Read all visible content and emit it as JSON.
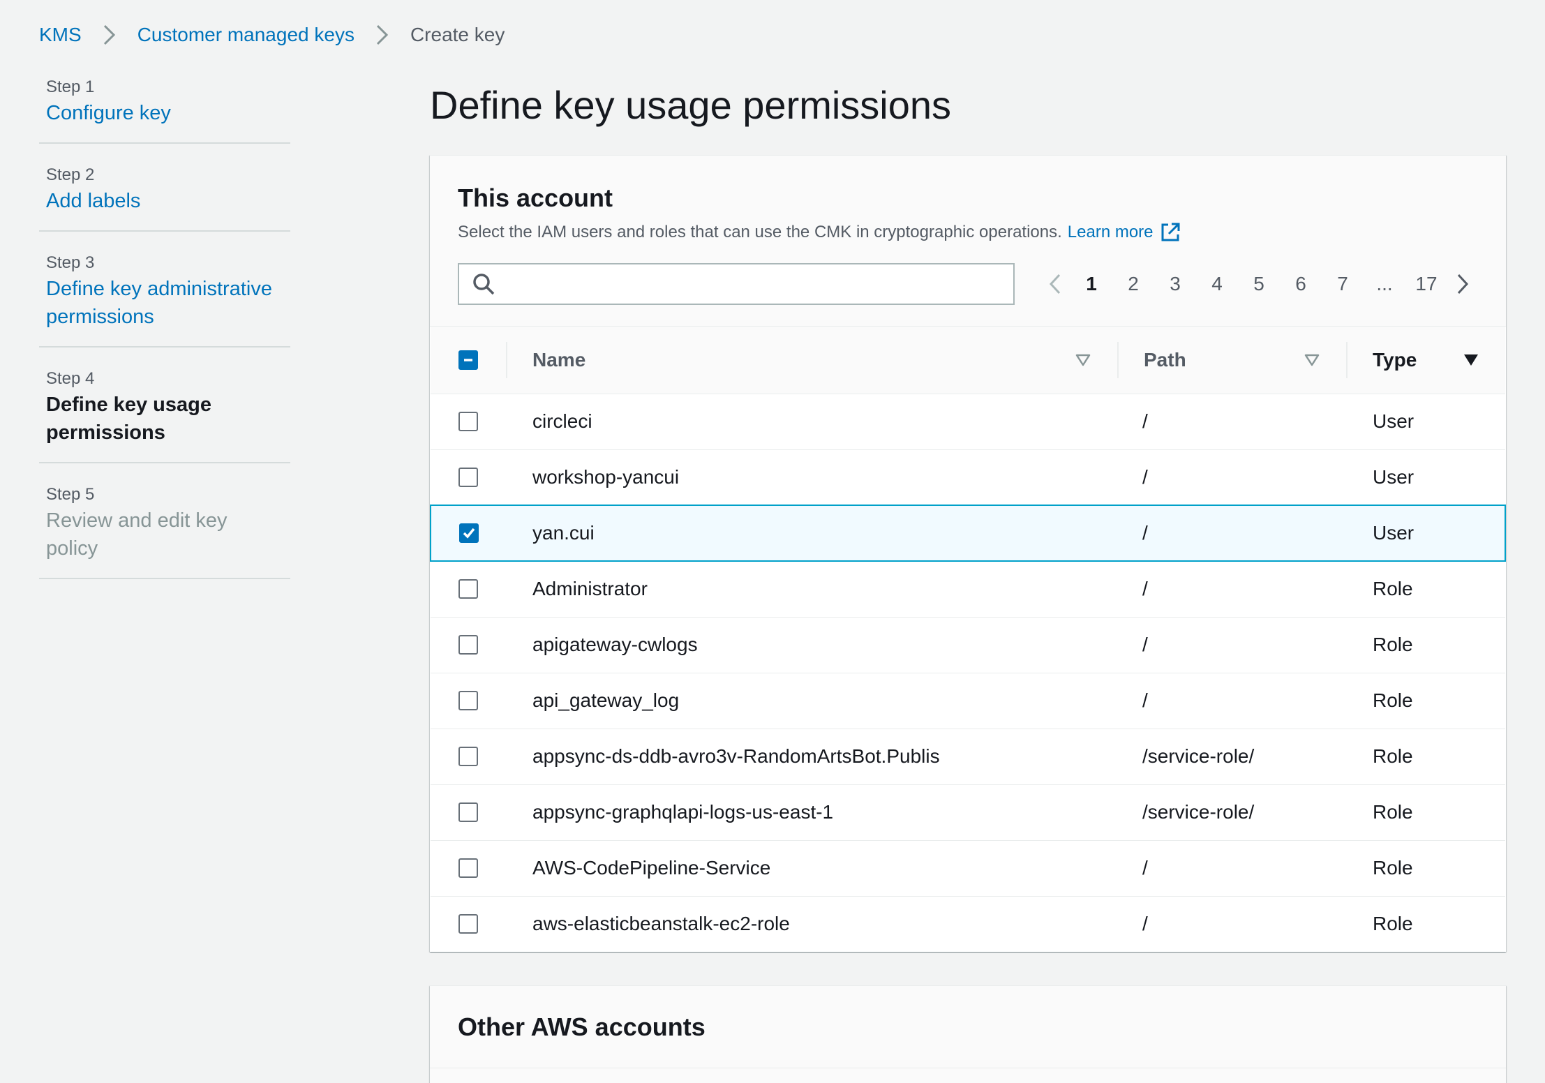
{
  "breadcrumb": {
    "items": [
      {
        "label": "KMS",
        "link": true
      },
      {
        "label": "Customer managed keys",
        "link": true
      },
      {
        "label": "Create key",
        "link": false
      }
    ]
  },
  "steps": [
    {
      "num": "Step 1",
      "title": "Configure key",
      "state": "link"
    },
    {
      "num": "Step 2",
      "title": "Add labels",
      "state": "link"
    },
    {
      "num": "Step 3",
      "title": "Define key administrative permissions",
      "state": "link"
    },
    {
      "num": "Step 4",
      "title": "Define key usage permissions",
      "state": "active"
    },
    {
      "num": "Step 5",
      "title": "Review and edit key policy",
      "state": "disabled"
    }
  ],
  "page": {
    "title": "Define key usage permissions"
  },
  "this_account": {
    "title": "This account",
    "description": "Select the IAM users and roles that can use the CMK in cryptographic operations.",
    "learn_more": "Learn more",
    "search_placeholder": "",
    "pagination": {
      "pages": [
        "1",
        "2",
        "3",
        "4",
        "5",
        "6",
        "7",
        "...",
        "17"
      ],
      "current": "1"
    },
    "columns": {
      "name": "Name",
      "path": "Path",
      "type": "Type"
    },
    "rows": [
      {
        "name": "circleci",
        "path": "/",
        "type": "User",
        "checked": false
      },
      {
        "name": "workshop-yancui",
        "path": "/",
        "type": "User",
        "checked": false
      },
      {
        "name": "yan.cui",
        "path": "/",
        "type": "User",
        "checked": true
      },
      {
        "name": "Administrator",
        "path": "/",
        "type": "Role",
        "checked": false
      },
      {
        "name": "apigateway-cwlogs",
        "path": "/",
        "type": "Role",
        "checked": false
      },
      {
        "name": "api_gateway_log",
        "path": "/",
        "type": "Role",
        "checked": false
      },
      {
        "name": "appsync-ds-ddb-avro3v-RandomArtsBot.Publis",
        "path": "/service-role/",
        "type": "Role",
        "checked": false
      },
      {
        "name": "appsync-graphqlapi-logs-us-east-1",
        "path": "/service-role/",
        "type": "Role",
        "checked": false
      },
      {
        "name": "AWS-CodePipeline-Service",
        "path": "/",
        "type": "Role",
        "checked": false
      },
      {
        "name": "aws-elasticbeanstalk-ec2-role",
        "path": "/",
        "type": "Role",
        "checked": false
      }
    ]
  },
  "other_accounts": {
    "title": "Other AWS accounts"
  },
  "colors": {
    "link": "#0073bb",
    "selected_border": "#00a1c9",
    "selected_bg": "#f1faff"
  }
}
